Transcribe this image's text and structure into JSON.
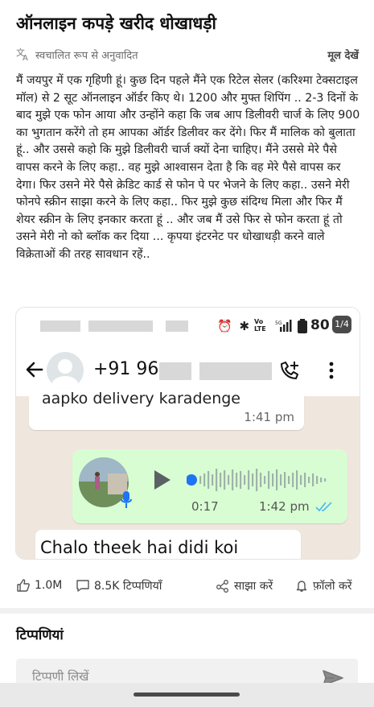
{
  "post": {
    "title": "ऑनलाइन कपड़े खरीद धोखाधड़ी",
    "auto_translated_label": "स्वचालित रूप से अनुवादित",
    "view_original_label": "मूल देखें",
    "body": "मैं जयपुर में एक गृहिणी हूं। कुछ दिन पहले मैंने एक रिटेल सेलर (करिश्मा टेक्सटाइल मॉल) से 2 सूट ऑनलाइन ऑर्डर किए थे। 1200 और मुफ्त शिपिंग .. 2-3 दिनों के बाद मुझे एक फोन आया और उन्होंने कहा कि जब आप डिलीवरी चार्ज के लिए 900 का भुगतान करेंगे तो हम आपका ऑर्डर डिलीवर कर देंगे। फिर मैं मालिक को बुलाता हूं.. और उससे कहो कि मुझे डिलीवरी चार्ज क्यों देना चाहिए। मैंने उससे मेरे पैसे वापस करने के लिए कहा.. वह मुझे आश्वासन देता है कि वह मेरे पैसे वापस कर देगा। फिर उसने मेरे पैसे क्रेडिट कार्ड से फोन पे पर भेजने के लिए कहा.. उसने मेरी फोनपे स्क्रीन साझा करने के लिए कहा.. फिर मुझे कुछ संदिग्ध मिला और फिर मैं शेयर स्क्रीन के लिए इनकार करता हूं .. और जब मैं उसे फिर से फोन करता हूं तो उसने मेरी नो को ब्लॉक कर दिया ... कृपया इंटरनेट पर धोखाधड़ी करने वाले विक्रेताओं की तरह सावधान रहें.."
  },
  "screenshot": {
    "page_badge": "1/4",
    "status_bar": {
      "volte": "Vo\nLTE",
      "signal": "⁵ᴳ",
      "battery": "80"
    },
    "contact_prefix": "+91 96",
    "messages": [
      {
        "text": "aapko delivery karadenge",
        "time": "1:41 pm"
      },
      {
        "duration": "0:17",
        "time": "1:42 pm"
      },
      {
        "text": "Chalo theek hai didi koi"
      }
    ]
  },
  "actions": {
    "likes": "1.0M",
    "comments": "8.5K टिप्पणियाँ",
    "share": "साझा करें",
    "follow": "फ़ॉलो करें"
  },
  "comments_section": {
    "title": "टिप्पणियां",
    "input_placeholder": "टिप्पणी लिखें"
  },
  "colors": {
    "chat_bg": "#efe7de",
    "voice_bubble": "#d9fdd3",
    "play_dot": "#1d74f5",
    "read_ticks": "#53bdeb"
  }
}
